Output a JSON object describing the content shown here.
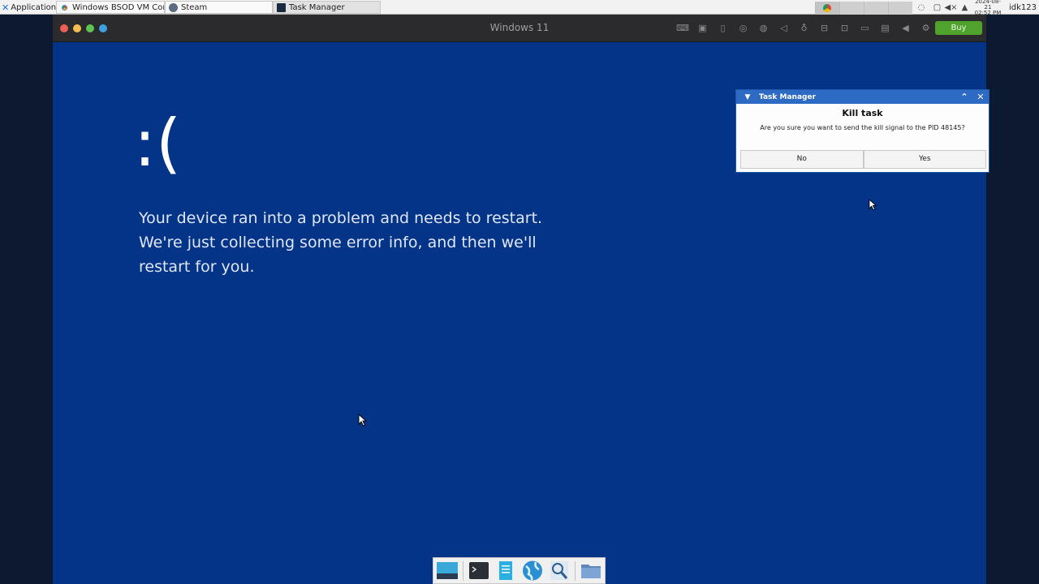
{
  "top_panel": {
    "applications_label": "Applications",
    "tasks": [
      {
        "label": "Windows BSOD VM Compi..."
      },
      {
        "label": "Steam"
      },
      {
        "label": "Task Manager"
      }
    ],
    "clock_date": "2024-08-21",
    "clock_time": "02:52 PM",
    "user": "idk123"
  },
  "vm_window": {
    "title": "Windows 11",
    "buy_label": "Buy",
    "traffic_light_colors": [
      "#ed5f56",
      "#f4bd4f",
      "#5fc453",
      "#3fa0e0"
    ]
  },
  "bsod": {
    "sad_face": ":(",
    "message_line1": "Your device ran into a problem and needs to restart.",
    "message_line2": "We're just collecting some error info, and then we'll",
    "message_line3": "restart for you.",
    "background_color": "#043488"
  },
  "dialog": {
    "window_title": "Task Manager",
    "heading": "Kill task",
    "text": "Are you sure you want to send the kill signal to the PID 48145?",
    "no_label": "No",
    "yes_label": "Yes"
  },
  "dock": {
    "items": [
      "desktop-icon",
      "terminal-icon",
      "text-editor-icon",
      "web-browser-icon",
      "search-icon",
      "file-manager-icon"
    ]
  }
}
